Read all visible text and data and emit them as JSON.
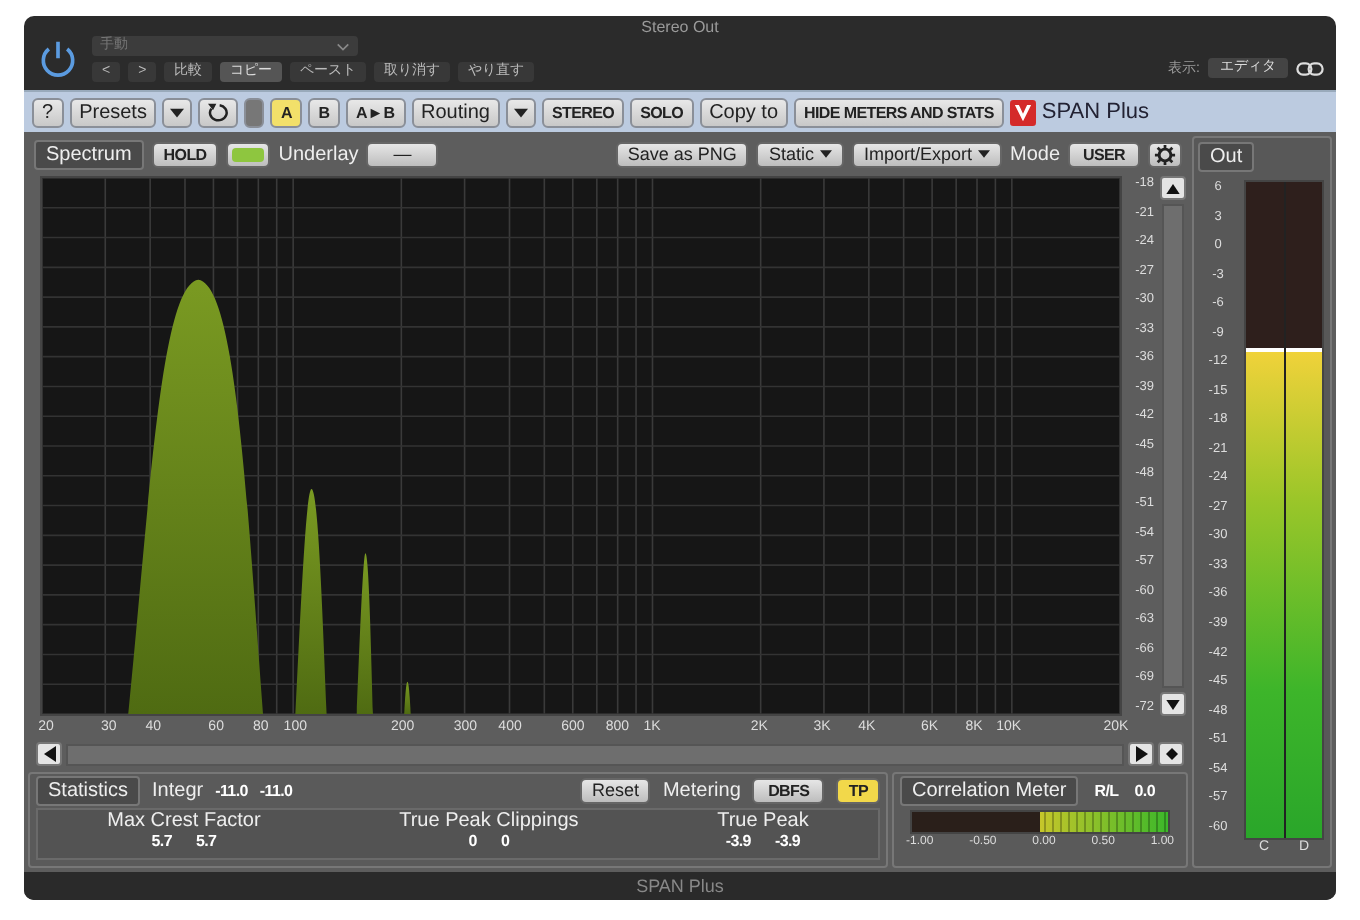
{
  "window": {
    "title": "Stereo Out",
    "preset": "手動",
    "footer": "SPAN Plus"
  },
  "host_bar": {
    "buttons": [
      "<",
      ">",
      "比較",
      "コピー",
      "ペースト",
      "取り消す",
      "やり直す"
    ],
    "view_label": "表示:",
    "view_value": "エディタ"
  },
  "toolbar": {
    "help": "?",
    "presets": "Presets",
    "ab": [
      {
        "label": "A",
        "selected": true
      },
      {
        "label": "B",
        "selected": false
      },
      {
        "label": "A►B",
        "selected": false
      }
    ],
    "routing": "Routing",
    "stereo": "STEREO",
    "solo": "SOLO",
    "copy_to": "Copy to",
    "hide": "HIDE METERS AND STATS",
    "brand": "SPAN Plus"
  },
  "spectrum": {
    "tab": "Spectrum",
    "hold": "HOLD",
    "hold_indicator_on": true,
    "underlay_label": "Underlay",
    "underlay_value": "—",
    "save": "Save as PNG",
    "static": "Static",
    "import_export": "Import/Export",
    "mode_label": "Mode",
    "mode_value": "USER",
    "db_labels": [
      "-18",
      "-21",
      "-24",
      "-27",
      "-30",
      "-33",
      "-36",
      "-39",
      "-42",
      "-45",
      "-48",
      "-51",
      "-54",
      "-57",
      "-60",
      "-63",
      "-66",
      "-69",
      "-72"
    ],
    "freq_labels": [
      "20",
      "30",
      "40",
      "60",
      "80",
      "100",
      "200",
      "300",
      "400",
      "600",
      "800",
      "1K",
      "2K",
      "3K",
      "4K",
      "6K",
      "8K",
      "10K",
      "20K"
    ]
  },
  "statistics": {
    "tab": "Statistics",
    "integr_label": "Integr",
    "integr_values": [
      "-11.0",
      "-11.0"
    ],
    "reset": "Reset",
    "metering_label": "Metering",
    "metering_value": "DBFS",
    "tp": {
      "label": "TP",
      "on": true
    },
    "groups": [
      {
        "label": "Max Crest Factor",
        "values": [
          "5.7",
          "5.7"
        ]
      },
      {
        "label": "True Peak Clippings",
        "values": [
          "0",
          "0"
        ]
      },
      {
        "label": "True Peak",
        "values": [
          "-3.9",
          "-3.9"
        ]
      }
    ]
  },
  "correlation": {
    "title": "Correlation Meter",
    "channel": "R/L",
    "value": "0.0",
    "level": 1,
    "ticks": [
      "-1.00",
      "-0.50",
      "0.00",
      "0.50",
      "1.00"
    ]
  },
  "out": {
    "title": "Out",
    "labels": [
      "6",
      "3",
      "0",
      "-3",
      "-6",
      "-9",
      "-12",
      "-15",
      "-18",
      "-21",
      "-24",
      "-27",
      "-30",
      "-33",
      "-36",
      "-39",
      "-42",
      "-45",
      "-48",
      "-51",
      "-54",
      "-57",
      "-60"
    ],
    "level": 0.74,
    "channels": [
      "C",
      "D"
    ]
  }
}
